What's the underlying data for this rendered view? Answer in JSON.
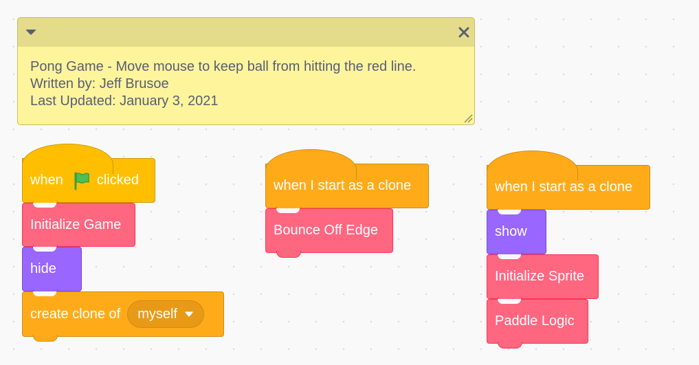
{
  "comment": {
    "lines": [
      "Pong Game - Move mouse to keep ball from hitting the red line.",
      "Written by: Jeff Brusoe",
      "Last Updated: January 3, 2021"
    ],
    "colors": {
      "body": "#fef49c",
      "header": "#e5dc8b"
    }
  },
  "scripts": [
    {
      "hat": {
        "before_icon": "when",
        "icon": "green-flag-icon",
        "after_icon": "clicked"
      },
      "blocks": [
        {
          "label": "Initialize Game",
          "category": "my-blocks"
        },
        {
          "label": "hide",
          "category": "looks"
        },
        {
          "label": "create clone of",
          "category": "control",
          "dropdown_value": "myself"
        }
      ]
    },
    {
      "hat": {
        "label": "when I start as a clone"
      },
      "blocks": [
        {
          "label": "Bounce Off Edge",
          "category": "my-blocks"
        }
      ]
    },
    {
      "hat": {
        "label": "when I start as a clone"
      },
      "blocks": [
        {
          "label": "show",
          "category": "looks"
        },
        {
          "label": "Initialize Sprite",
          "category": "my-blocks"
        },
        {
          "label": "Paddle Logic",
          "category": "my-blocks"
        }
      ]
    }
  ],
  "colors": {
    "events": "#ffbf00",
    "control": "#ffab19",
    "my_blocks": "#ff6680",
    "looks": "#9966ff",
    "workspace": "#f9f9f9"
  }
}
